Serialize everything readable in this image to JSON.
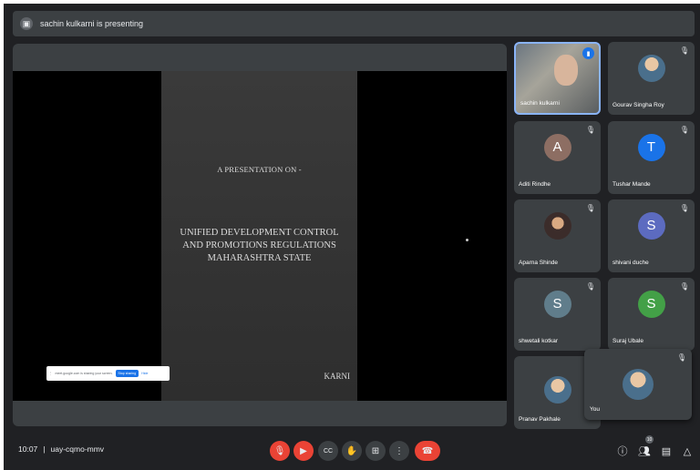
{
  "banner": {
    "text": "sachin kulkarni is presenting",
    "icon": "present-icon"
  },
  "slide": {
    "pre": "A PRESENTATION ON -",
    "title_lines": [
      "UNIFIED DEVELOPMENT CONTROL",
      "AND PROMOTIONS REGULATIONS",
      "MAHARASHTRA STATE"
    ],
    "partial_author": "KARNI"
  },
  "sharebar": {
    "message": "meet.google.com is sharing your screen.",
    "stop_label": "Stop sharing",
    "hide_label": "Hide"
  },
  "participants": [
    {
      "name": "sachin kulkarni",
      "type": "video",
      "speaking": true
    },
    {
      "name": "Gourav Singha Roy",
      "type": "photo",
      "muted": true
    },
    {
      "name": "Aditi Rindhe",
      "initial": "A",
      "color": "#8d6e63",
      "muted": true
    },
    {
      "name": "Tushar Mande",
      "initial": "T",
      "color": "#1a73e8",
      "muted": true
    },
    {
      "name": "Aparna Shinde",
      "type": "photo",
      "muted": true
    },
    {
      "name": "shivani duche",
      "initial": "S",
      "color": "#5c6bc0",
      "muted": true
    },
    {
      "name": "shwetali kotkar",
      "initial": "S",
      "color": "#607d8b",
      "muted": true
    },
    {
      "name": "Suraj Ubale",
      "initial": "S",
      "color": "#43a047",
      "muted": true
    },
    {
      "name": "Pranav Pakhale",
      "type": "photo",
      "muted": false
    }
  ],
  "self_tile": {
    "name": "You",
    "muted": true
  },
  "bottom": {
    "time": "10:07",
    "meeting_code": "uay-cqmo-mmv",
    "participant_count": "10"
  },
  "colors": {
    "background": "#202124",
    "tile": "#3c4043",
    "danger": "#ea4335",
    "accent": "#1a73e8"
  }
}
